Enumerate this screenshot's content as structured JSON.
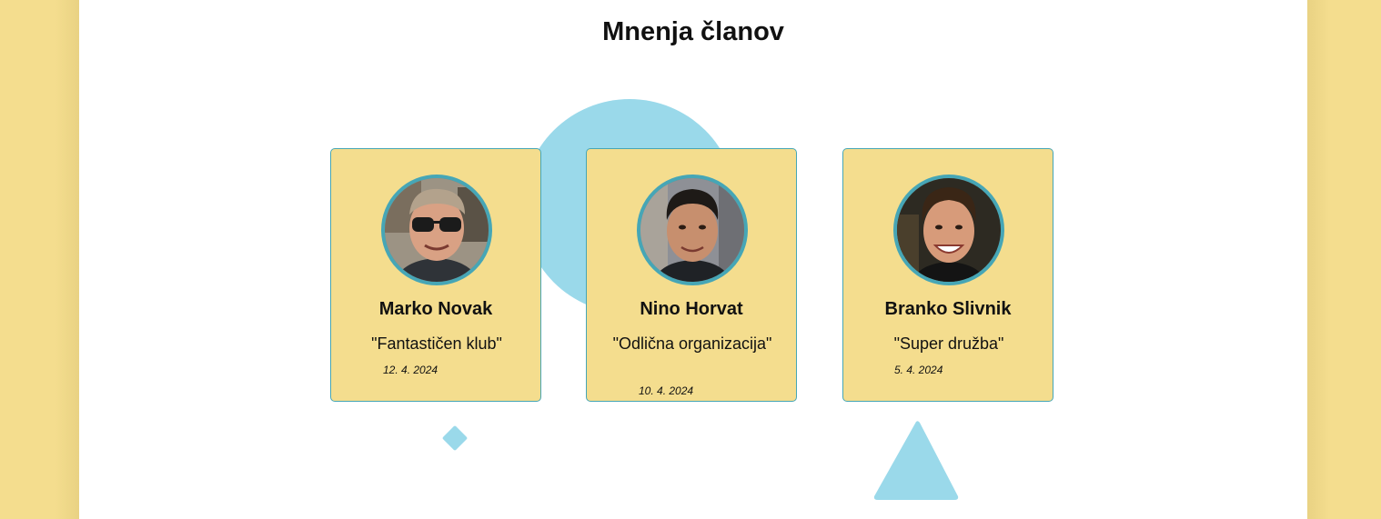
{
  "page": {
    "title": "Mnenja članov"
  },
  "colors": {
    "page_background": "#f4dd8e",
    "content_background": "#ffffff",
    "card_background": "#f4dd8e",
    "card_border": "#46a6b6",
    "decoration": "#9ad9ea"
  },
  "testimonials": [
    {
      "name": "Marko Novak",
      "quote": "\"Fantastičen klub\"",
      "date": "12. 4. 2024",
      "avatar_icon": "man-sunglasses-photo"
    },
    {
      "name": "Nino Horvat",
      "quote": "\"Odlična organizacija\"",
      "date": "10. 4. 2024",
      "avatar_icon": "young-man-photo"
    },
    {
      "name": "Branko Slivnik",
      "quote": "\"Super družba\"",
      "date": "5. 4. 2024",
      "avatar_icon": "teen-boy-photo"
    }
  ]
}
